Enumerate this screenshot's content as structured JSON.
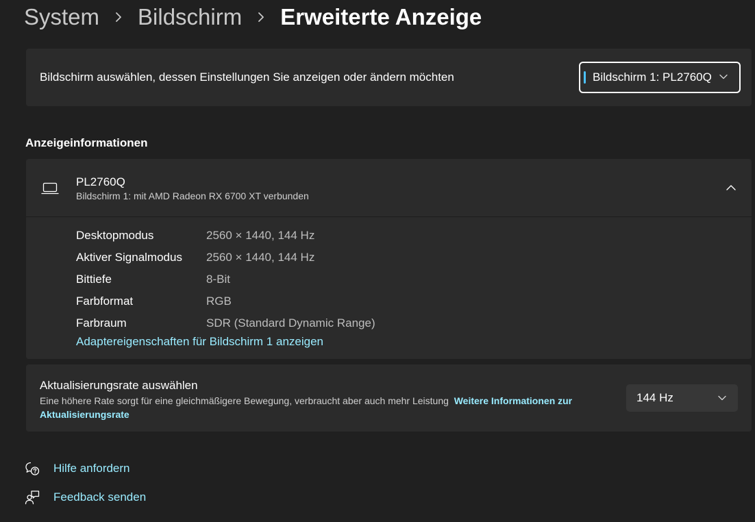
{
  "breadcrumb": {
    "items": [
      "System",
      "Bildschirm"
    ],
    "current": "Erweiterte Anzeige"
  },
  "display_select": {
    "label": "Bildschirm auswählen, dessen Einstellungen Sie anzeigen oder ändern möchten",
    "selected": "Bildschirm 1: PL2760Q"
  },
  "section": {
    "title": "Anzeigeinformationen"
  },
  "display_info": {
    "name": "PL2760Q",
    "subtitle": "Bildschirm 1: mit AMD Radeon RX 6700 XT verbunden",
    "rows": [
      {
        "key": "Desktopmodus",
        "value": "2560 × 1440, 144 Hz"
      },
      {
        "key": "Aktiver Signalmodus",
        "value": "2560 × 1440, 144 Hz"
      },
      {
        "key": "Bittiefe",
        "value": "8-Bit"
      },
      {
        "key": "Farbformat",
        "value": "RGB"
      },
      {
        "key": "Farbraum",
        "value": "SDR (Standard Dynamic Range)"
      }
    ],
    "adapter_link": "Adaptereigenschaften für Bildschirm 1 anzeigen"
  },
  "refresh": {
    "title": "Aktualisierungsrate auswählen",
    "description": "Eine höhere Rate sorgt für eine gleichmäßigere Bewegung, verbraucht aber auch mehr Leistung",
    "more_link": "Weitere Informationen zur Aktualisierungsrate",
    "selected": "144 Hz"
  },
  "links": {
    "help": "Hilfe anfordern",
    "feedback": "Feedback senden"
  },
  "colors": {
    "background": "#202020",
    "card": "#2b2b2b",
    "accent": "#4cc2ff",
    "link": "#99ebff"
  },
  "icons": {
    "breadcrumb_separator": "chevron-right-icon",
    "dropdown": "chevron-down-icon",
    "display": "laptop-icon",
    "collapse": "chevron-up-icon",
    "help": "help-chat-icon",
    "feedback": "feedback-person-icon"
  }
}
